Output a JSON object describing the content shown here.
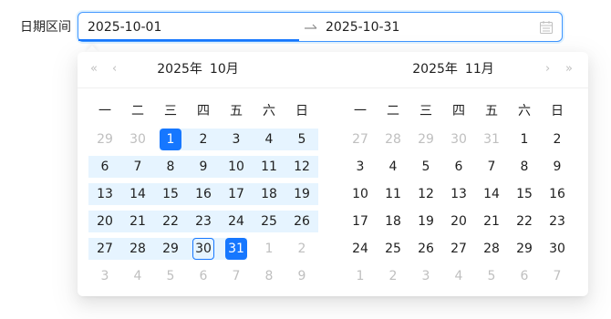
{
  "field": {
    "label": "日期区间"
  },
  "range": {
    "start": "2025-10-01",
    "end": "2025-10-31"
  },
  "icons": {
    "separator": "swap-right-arrow-icon",
    "calendar": "calendar-icon"
  },
  "colors": {
    "accent": "#1677ff",
    "range_bg": "#e6f4ff",
    "muted": "#bfbfbf"
  },
  "left_panel": {
    "year": "2025年",
    "month": "10月",
    "nav_super_prev": "«",
    "nav_prev": "‹"
  },
  "right_panel": {
    "year": "2025年",
    "month": "11月",
    "nav_next": "›",
    "nav_super_next": "»"
  },
  "weekdays": [
    "一",
    "二",
    "三",
    "四",
    "五",
    "六",
    "日"
  ],
  "october_weeks": [
    [
      "29",
      "30",
      "1",
      "2",
      "3",
      "4",
      "5"
    ],
    [
      "6",
      "7",
      "8",
      "9",
      "10",
      "11",
      "12"
    ],
    [
      "13",
      "14",
      "15",
      "16",
      "17",
      "18",
      "19"
    ],
    [
      "20",
      "21",
      "22",
      "23",
      "24",
      "25",
      "26"
    ],
    [
      "27",
      "28",
      "29",
      "30",
      "31",
      "1",
      "2"
    ],
    [
      "3",
      "4",
      "5",
      "6",
      "7",
      "8",
      "9"
    ]
  ],
  "november_weeks": [
    [
      "27",
      "28",
      "29",
      "30",
      "31",
      "1",
      "2"
    ],
    [
      "3",
      "4",
      "5",
      "6",
      "7",
      "8",
      "9"
    ],
    [
      "10",
      "11",
      "12",
      "13",
      "14",
      "15",
      "16"
    ],
    [
      "17",
      "18",
      "19",
      "20",
      "21",
      "22",
      "23"
    ],
    [
      "24",
      "25",
      "26",
      "27",
      "28",
      "29",
      "30"
    ],
    [
      "1",
      "2",
      "3",
      "4",
      "5",
      "6",
      "7"
    ]
  ]
}
